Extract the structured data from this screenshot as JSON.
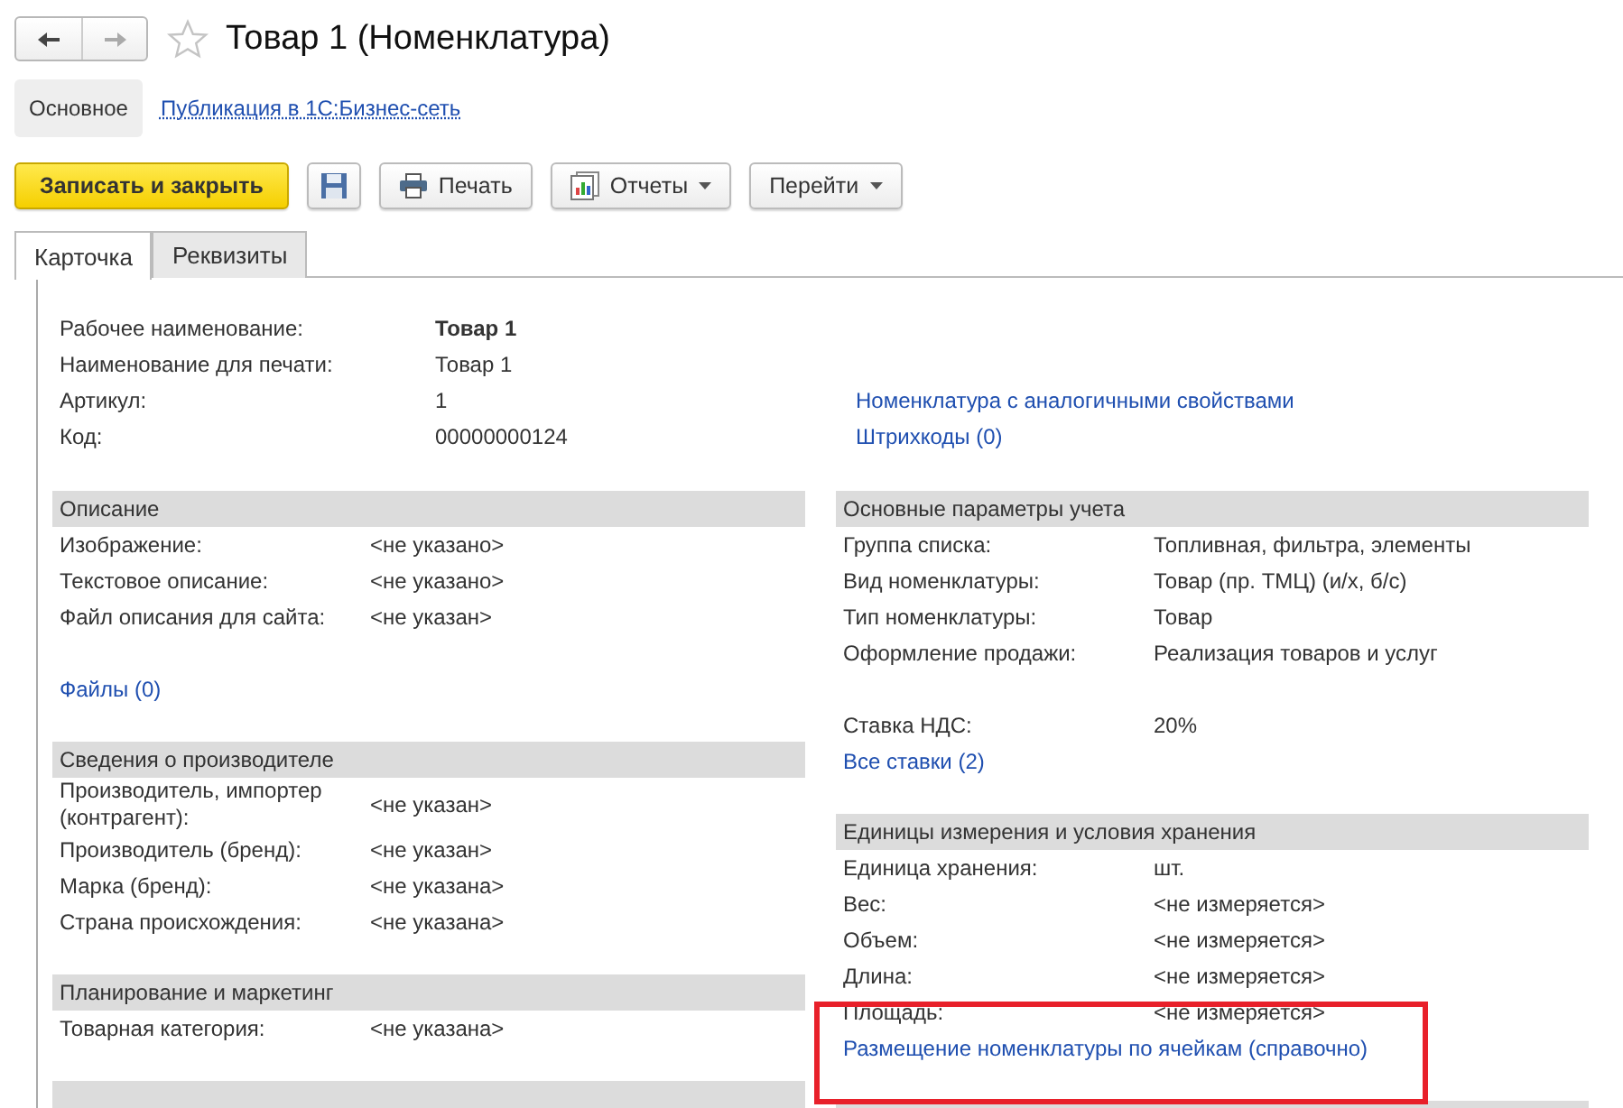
{
  "nav": [
    {
      "kind": "back",
      "disabled": false
    },
    {
      "kind": "forward",
      "disabled": true
    }
  ],
  "favorite": false,
  "title": "Товар 1 (Номенклатура)",
  "sections": [
    {
      "label": "Основное",
      "selected": true
    },
    {
      "label": "Публикация в 1С:Бизнес-сеть",
      "selected": false
    }
  ],
  "toolbar": [
    {
      "kind": "primary",
      "label": "Записать и закрыть"
    },
    {
      "kind": "save"
    },
    {
      "kind": "print",
      "label": "Печать"
    },
    {
      "kind": "reports",
      "label": "Отчеты",
      "dropdown": true
    },
    {
      "kind": "plain",
      "label": "Перейти",
      "dropdown": true
    }
  ],
  "tabs": [
    {
      "label": "Карточка",
      "selected": true
    },
    {
      "label": "Реквизиты",
      "selected": false
    }
  ],
  "header_fields": [
    {
      "label": "Рабочее наименование:",
      "value": "Товар 1",
      "bold": true
    },
    {
      "label": "Наименование для печати:",
      "value": "Товар 1",
      "bold": false
    },
    {
      "label": "Артикул:",
      "value": "1",
      "bold": false
    },
    {
      "label": "Код:",
      "value": "00000000124",
      "bold": false
    }
  ],
  "header_links": [
    "Номенклатура с аналогичными свойствами",
    "Штрихкоды (0)"
  ],
  "left_groups": [
    {
      "title": "Описание",
      "blocks": [
        [
          {
            "kind": "field",
            "label": "Изображение:",
            "value": "<не указано>"
          },
          {
            "kind": "field",
            "label": "Текстовое описание:",
            "value": "<не указано>"
          },
          {
            "kind": "field",
            "label": "Файл описания для сайта:",
            "value": "<не указан>"
          }
        ],
        [
          {
            "kind": "link",
            "label": "Файлы (0)",
            "highlighted": false
          }
        ]
      ]
    },
    {
      "title": "Сведения о производителе",
      "blocks": [
        [
          {
            "kind": "field",
            "label": "Производитель, импортер (контрагент):",
            "value": "<не указан>"
          },
          {
            "kind": "field",
            "label": "Производитель (бренд):",
            "value": "<не указан>"
          },
          {
            "kind": "field",
            "label": "Марка (бренд):",
            "value": "<не указана>"
          },
          {
            "kind": "field",
            "label": "Страна происхождения:",
            "value": "<не указана>"
          }
        ]
      ]
    },
    {
      "title": "Планирование и маркетинг",
      "blocks": [
        [
          {
            "kind": "field",
            "label": "Товарная категория:",
            "value": "<не указана>"
          }
        ]
      ]
    }
  ],
  "right_groups": [
    {
      "title": "Основные параметры учета",
      "blocks": [
        [
          {
            "kind": "field",
            "label": "Группа списка:",
            "value": "Топливная, фильтра, элементы"
          },
          {
            "kind": "field",
            "label": "Вид номенклатуры:",
            "value": "Товар (пр. ТМЦ) (и/х, б/с)"
          },
          {
            "kind": "field",
            "label": "Тип номенклатуры:",
            "value": "Товар"
          },
          {
            "kind": "field",
            "label": "Оформление продажи:",
            "value": "Реализация товаров и услуг"
          }
        ],
        [
          {
            "kind": "field",
            "label": "Ставка НДС:",
            "value": "20%"
          },
          {
            "kind": "link",
            "label": "Все ставки (2)",
            "highlighted": false
          }
        ]
      ]
    },
    {
      "title": "Единицы измерения и условия хранения",
      "blocks": [
        [
          {
            "kind": "field",
            "label": "Единица хранения:",
            "value": "шт."
          },
          {
            "kind": "field",
            "label": "Вес:",
            "value": "<не измеряется>"
          },
          {
            "kind": "field",
            "label": "Объем:",
            "value": "<не измеряется>"
          },
          {
            "kind": "field",
            "label": "Длина:",
            "value": "<не измеряется>"
          },
          {
            "kind": "field",
            "label": "Площадь:",
            "value": "<не измеряется>"
          },
          {
            "kind": "link",
            "label": "Размещение номенклатуры по ячейкам (справочно)",
            "highlighted": true
          }
        ]
      ]
    }
  ]
}
